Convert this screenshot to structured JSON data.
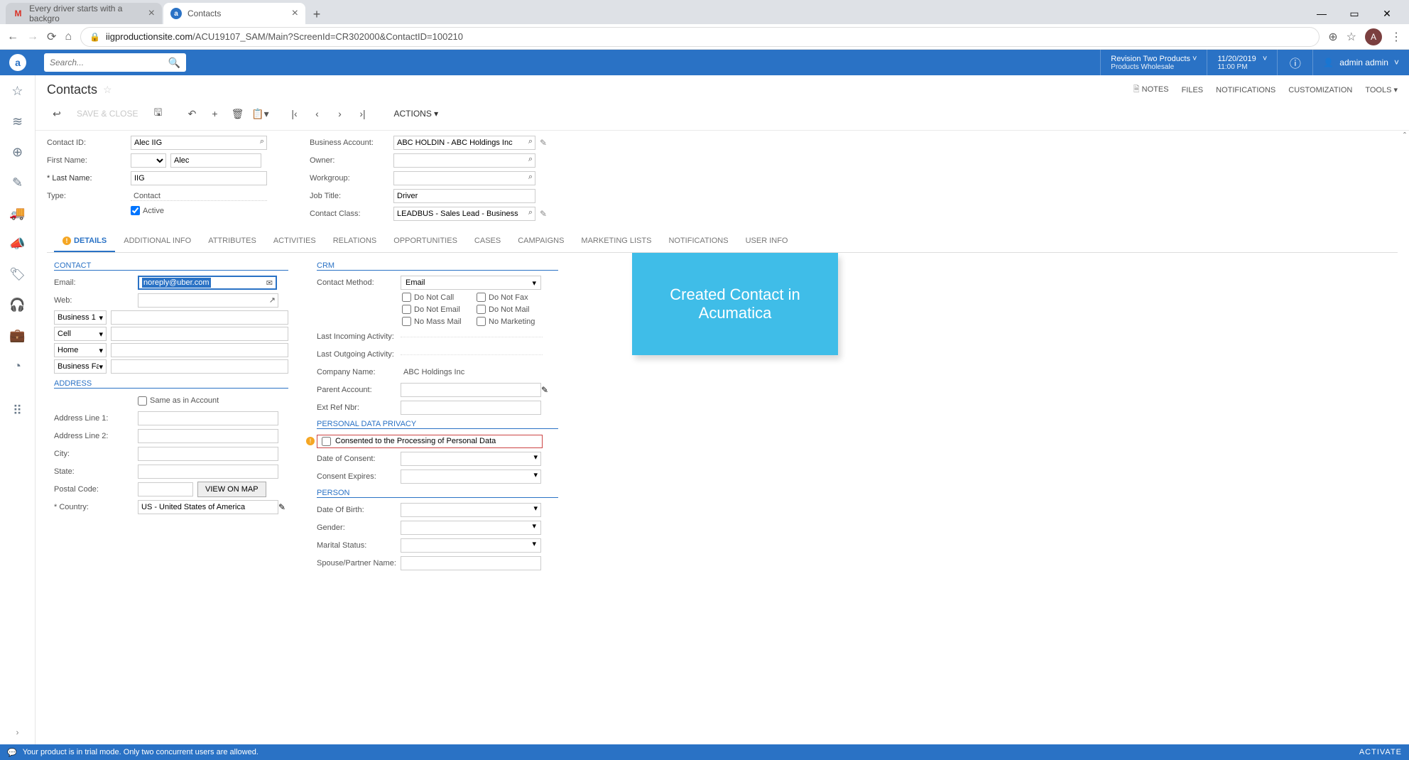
{
  "browser": {
    "tabs": [
      {
        "icon": "M",
        "icon_color": "#d93025",
        "title": "Every driver starts with a backgro"
      },
      {
        "icon": "a",
        "icon_color": "#2a72c5",
        "title": "Contacts"
      }
    ],
    "url_host": "iigproductionsite.com",
    "url_path": "/ACU19107_SAM/Main?ScreenId=CR302000&ContactID=100210",
    "avatar": "A"
  },
  "top": {
    "search_placeholder": "Search...",
    "company": "Revision Two Products",
    "company_sub": "Products Wholesale",
    "date": "11/20/2019",
    "time": "11:00 PM",
    "user": "admin admin"
  },
  "page": {
    "title": "Contacts",
    "menus": {
      "notes": "NOTES",
      "files": "FILES",
      "notifications": "NOTIFICATIONS",
      "customization": "CUSTOMIZATION",
      "tools": "TOOLS ▾"
    }
  },
  "toolbar": {
    "save_close": "SAVE & CLOSE",
    "actions": "ACTIONS ▾"
  },
  "form": {
    "contact_id_label": "Contact ID:",
    "contact_id": "Alec IIG",
    "first_name_label": "First Name:",
    "first_name": "Alec",
    "last_name_label": "Last Name:",
    "last_name": "IIG",
    "type_label": "Type:",
    "type": "Contact",
    "active_label": "Active",
    "ba_label": "Business Account:",
    "ba": "ABC HOLDIN - ABC Holdings Inc",
    "owner_label": "Owner:",
    "owner": "",
    "workgroup_label": "Workgroup:",
    "workgroup": "",
    "jobtitle_label": "Job Title:",
    "jobtitle": "Driver",
    "cclass_label": "Contact Class:",
    "cclass": "LEADBUS - Sales Lead - Business"
  },
  "tabs": {
    "details": "DETAILS",
    "addinfo": "ADDITIONAL INFO",
    "attributes": "ATTRIBUTES",
    "activities": "ACTIVITIES",
    "relations": "RELATIONS",
    "opportunities": "OPPORTUNITIES",
    "cases": "CASES",
    "campaigns": "CAMPAIGNS",
    "mlists": "MARKETING LISTS",
    "notifications": "NOTIFICATIONS",
    "userinfo": "USER INFO"
  },
  "details": {
    "contact_head": "CONTACT",
    "email_label": "Email:",
    "email": "noreply@uber.com",
    "web_label": "Web:",
    "phone_types": [
      "Business 1",
      "Cell",
      "Home",
      "Business Fax"
    ],
    "address_head": "ADDRESS",
    "same_label": "Same as in Account",
    "addr1_label": "Address Line 1:",
    "addr2_label": "Address Line 2:",
    "city_label": "City:",
    "state_label": "State:",
    "postal_label": "Postal Code:",
    "viewmap": "VIEW ON MAP",
    "country_label": "Country:",
    "country": "US - United States of America",
    "crm_head": "CRM",
    "cmethod_label": "Contact Method:",
    "cmethod": "Email",
    "dnc": "Do Not Call",
    "dnf": "Do Not Fax",
    "dne": "Do Not Email",
    "dnm": "Do Not Mail",
    "nmm": "No Mass Mail",
    "nmk": "No Marketing",
    "lia_label": "Last Incoming Activity:",
    "loa_label": "Last Outgoing Activity:",
    "cname_label": "Company Name:",
    "cname": "ABC Holdings Inc",
    "pacct_label": "Parent Account:",
    "eref_label": "Ext Ref Nbr:",
    "pdp_head": "PERSONAL DATA PRIVACY",
    "consent_label": "Consented to the Processing of Personal Data",
    "doc_label": "Date of Consent:",
    "cexp_label": "Consent Expires:",
    "person_head": "PERSON",
    "dob_label": "Date Of Birth:",
    "gender_label": "Gender:",
    "mstat_label": "Marital Status:",
    "spouse_label": "Spouse/Partner Name:"
  },
  "callout": "Created Contact in Acumatica",
  "footer": {
    "msg": "Your product is in trial mode. Only two concurrent users are allowed.",
    "activate": "ACTIVATE"
  }
}
